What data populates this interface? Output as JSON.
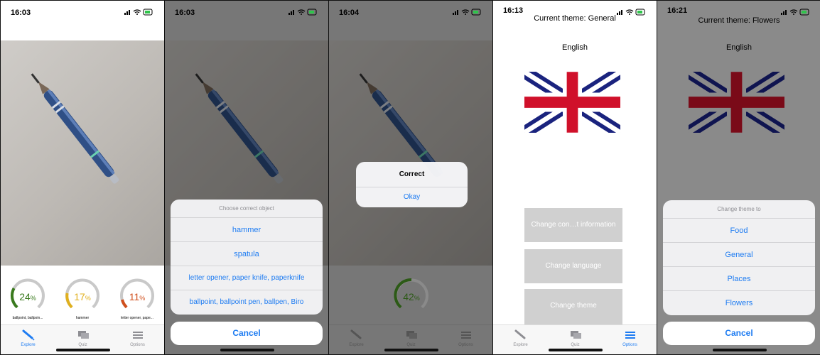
{
  "screens": {
    "s1": {
      "time": "16:03"
    },
    "s2": {
      "time": "16:03"
    },
    "s3": {
      "time": "16:04"
    },
    "s4": {
      "time": "16:13"
    },
    "s5": {
      "time": "16:21"
    }
  },
  "predictions": [
    {
      "value": "24",
      "unit": "%",
      "label": "ballpoint, ballpoin...",
      "color": "#3a7a1e",
      "fraction": 0.24
    },
    {
      "value": "17",
      "unit": "%",
      "label": "hammer",
      "color": "#e0b01e",
      "fraction": 0.17
    },
    {
      "value": "11",
      "unit": "%",
      "label": "letter opener, pape...",
      "color": "#d0501e",
      "fraction": 0.11
    }
  ],
  "tabs": {
    "explore": "Explore",
    "quiz": "Quiz",
    "options": "Options"
  },
  "choose_sheet": {
    "header": "Choose correct object",
    "options": [
      "hammer",
      "spatula",
      "letter opener, paper knife, paperknife",
      "ballpoint, ballpoint pen, ballpen, Biro"
    ],
    "cancel": "Cancel"
  },
  "alert": {
    "title": "Correct",
    "button": "Okay",
    "gauge_value": "42",
    "gauge_unit": "%",
    "gauge_fraction": 0.42,
    "gauge_color": "#3a7a1e"
  },
  "options_screen": {
    "theme_text": "Current theme: General",
    "language": "English",
    "buttons": [
      "Change con…t information",
      "Change language",
      "Change theme"
    ]
  },
  "theme_sheet": {
    "theme_text": "Current theme: Flowers",
    "language": "English",
    "header": "Change theme to",
    "options": [
      "Food",
      "General",
      "Places",
      "Flowers"
    ],
    "cancel": "Cancel"
  },
  "colors": {
    "accent": "#1e7cf2",
    "gauge_track": "#c9c9c9"
  }
}
